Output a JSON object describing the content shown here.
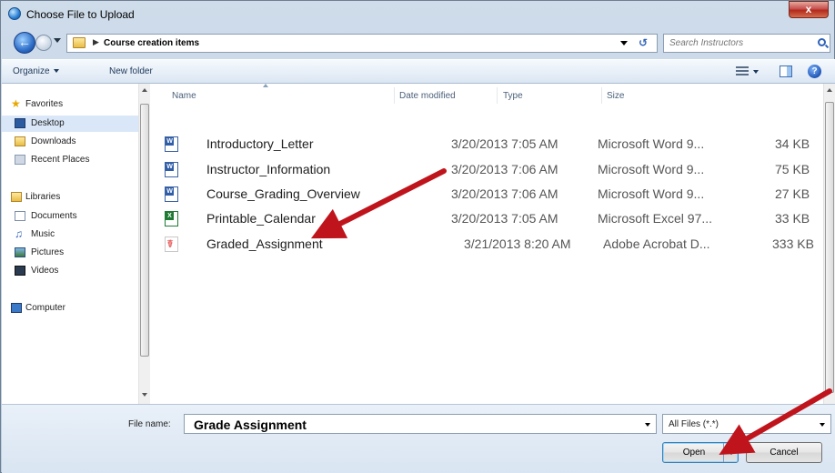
{
  "window": {
    "title": "Choose File to Upload",
    "close_label": "x"
  },
  "address": {
    "path": "Course creation items",
    "search_placeholder": "Search Instructors"
  },
  "toolbar": {
    "organize_label": "Organize",
    "new_folder_label": "New folder"
  },
  "nav": {
    "favorites": "Favorites",
    "desktop": "Desktop",
    "downloads": "Downloads",
    "recent": "Recent Places",
    "libraries": "Libraries",
    "documents": "Documents",
    "music": "Music",
    "pictures": "Pictures",
    "videos": "Videos",
    "computer": "Computer"
  },
  "columns": {
    "name": "Name",
    "date": "Date modified",
    "type": "Type",
    "size": "Size"
  },
  "files": [
    {
      "name": "Introductory_Letter",
      "date": "3/20/2013 7:05 AM",
      "type": "Microsoft Word 9...",
      "size": "34 KB",
      "icon": "word-doc-icon"
    },
    {
      "name": "Instructor_Information",
      "date": "3/20/2013 7:06 AM",
      "type": "Microsoft Word 9...",
      "size": "75 KB",
      "icon": "word-doc-icon"
    },
    {
      "name": "Course_Grading_Overview",
      "date": "3/20/2013 7:06 AM",
      "type": "Microsoft Word 9...",
      "size": "27 KB",
      "icon": "word-doc-icon"
    },
    {
      "name": "Printable_Calendar",
      "date": "3/20/2013 7:05 AM",
      "type": "Microsoft Excel 97...",
      "size": "33 KB",
      "icon": "excel-doc-icon"
    },
    {
      "name": "Graded_Assignment",
      "date": "3/21/2013 8:20 AM",
      "type": "Adobe Acrobat D...",
      "size": "333 KB",
      "icon": "pdf-doc-icon"
    }
  ],
  "bottom": {
    "file_name_label": "File name:",
    "file_name_value": "Grade Assignment",
    "filter_label": "All Files (*.*)",
    "open_label": "Open",
    "cancel_label": "Cancel"
  },
  "colors": {
    "annotation_arrow": "#c0141c",
    "frame": "#c6d6e9"
  }
}
